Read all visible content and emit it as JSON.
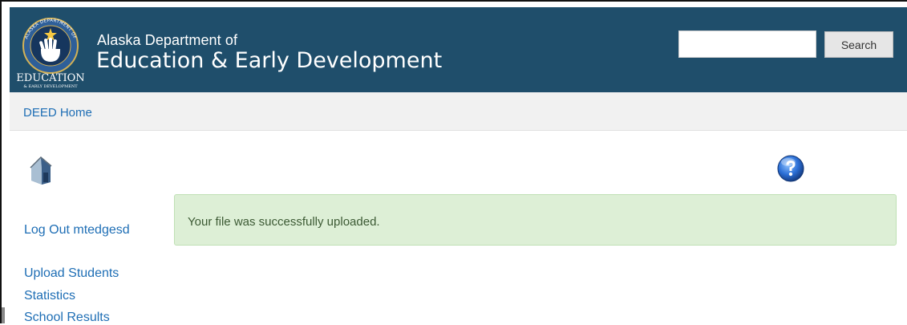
{
  "header": {
    "dept_label": "Alaska Department of",
    "agency_name": "Education & Early Development",
    "logo": {
      "ring_text": "ALASKA DEPARTMENT OF",
      "word": "EDUCATION",
      "sub": "& EARLY DEVELOPMENT"
    },
    "search": {
      "value": "",
      "placeholder": "",
      "button_label": "Search"
    }
  },
  "nav": {
    "home_link": "DEED Home"
  },
  "sidebar": {
    "logout_label": "Log Out mtedgesd",
    "links": [
      "Upload Students",
      "Statistics",
      "School Results"
    ]
  },
  "alert": {
    "message": "Your file was successfully uploaded."
  },
  "icons": {
    "home": "home-icon",
    "help": "help-icon"
  },
  "colors": {
    "header_bg": "#1f4e6b",
    "link": "#1e6eb5",
    "alert_bg": "#ddefd6",
    "alert_border": "#bfe0b4",
    "alert_text": "#3c5a34",
    "nav_bg": "#f1f1f1"
  }
}
